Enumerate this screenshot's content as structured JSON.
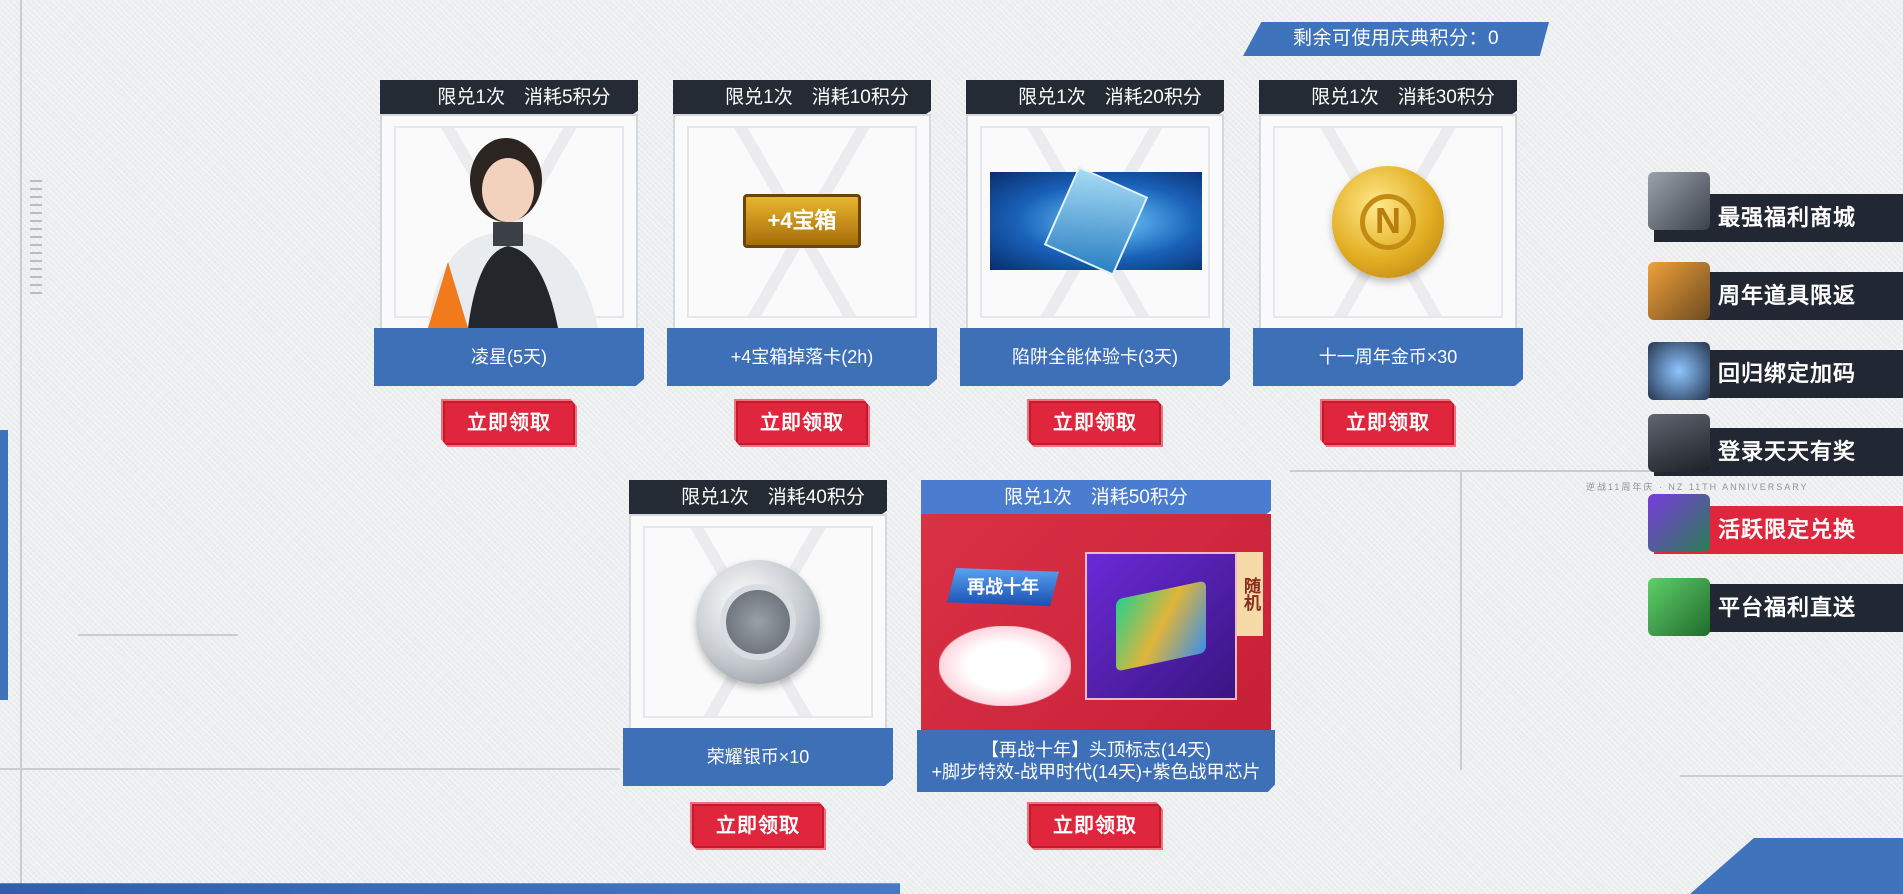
{
  "points": {
    "text": "剩余可使用庆典积分：0"
  },
  "cards": [
    {
      "head": "限兑1次　消耗5积分",
      "name": "凌星(5天)",
      "claim": "立即领取",
      "art": "character-portrait"
    },
    {
      "head": "限兑1次　消耗10积分",
      "name": "+4宝箱掉落卡(2h)",
      "claim": "立即领取",
      "art": "drop-card",
      "art_text": "+4宝箱"
    },
    {
      "head": "限兑1次　消耗20积分",
      "name": "陷阱全能体验卡(3天)",
      "claim": "立即领取",
      "art": "trap-card"
    },
    {
      "head": "限兑1次　消耗30积分",
      "name": "十一周年金币×30",
      "claim": "立即领取",
      "art": "gold-coin",
      "art_text": "N"
    },
    {
      "head": "限兑1次　消耗40积分",
      "name": "荣耀银币×10",
      "claim": "立即领取",
      "art": "silver-coin"
    }
  ],
  "special_card": {
    "head": "限兑1次　消耗50积分",
    "name_line1": "【再战十年】头顶标志(14天)",
    "name_line2": "+脚步特效-战甲时代(14天)+紫色战甲芯片",
    "tag": "随机",
    "logo": "再战十年",
    "claim": "立即领取"
  },
  "nav": [
    {
      "label": "最强福利商城",
      "icon": "dragon-icon"
    },
    {
      "label": "周年道具限返",
      "icon": "creature-icon"
    },
    {
      "label": "回归绑定加码",
      "icon": "logo-icon"
    },
    {
      "label": "登录天天有奖",
      "icon": "rifle-icon"
    },
    {
      "label": "活跃限定兑换",
      "icon": "chip-box-icon",
      "active": true
    },
    {
      "label": "平台福利直送",
      "icon": "coupon-icon"
    }
  ],
  "anniversary_text": "逆战11周年庆 · NZ 11TH ANNIVERSARY",
  "colors": {
    "accent_red": "#e0263c",
    "accent_blue": "#3e70b8",
    "dark": "#252b35"
  }
}
